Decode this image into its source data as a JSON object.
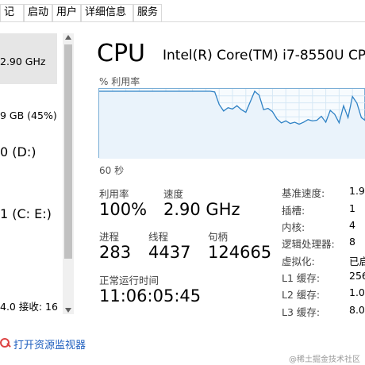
{
  "tabs": [
    "记录",
    "启动",
    "用户",
    "详细信息",
    "服务"
  ],
  "left_list": {
    "item1_value": "2.90 GHz",
    "item2_value": "9 GB (45%)",
    "item3_value": "0 (D:)",
    "item4_value": "1 (C: E:)",
    "item5_value": "4.0 接收: 16"
  },
  "footer_link": "打开资源监视器",
  "cpu": {
    "title": "CPU",
    "model": "Intel(R) Core(TM) i7-8550U CP",
    "util_axis_label": "% 利用率",
    "seconds_label": "60 秒",
    "utilization_label": "利用率",
    "utilization_value": "100%",
    "speed_label": "速度",
    "speed_value": "2.90 GHz",
    "processes_label": "进程",
    "processes_value": "283",
    "threads_label": "线程",
    "threads_value": "4437",
    "handles_label": "句柄",
    "handles_value": "124665",
    "uptime_label": "正常运行时间",
    "uptime_value": "11:06:05:45"
  },
  "specs": [
    {
      "key": "基准速度:",
      "value": "1.9"
    },
    {
      "key": "插槽:",
      "value": "1"
    },
    {
      "key": "内核:",
      "value": "4"
    },
    {
      "key": "逻辑处理器:",
      "value": "8"
    },
    {
      "key": "虚拟化:",
      "value": "已启"
    },
    {
      "key": "L1 缓存:",
      "value": "256"
    },
    {
      "key": "L2 缓存:",
      "value": "1.0"
    },
    {
      "key": "L3 缓存:",
      "value": "8.0"
    }
  ],
  "chart_data": {
    "type": "line",
    "ylim": [
      0,
      100
    ],
    "xlim": [
      0,
      60
    ],
    "grid": true,
    "x": [
      0,
      5,
      10,
      15,
      20,
      25,
      26,
      27,
      28,
      29,
      30,
      31,
      32,
      33,
      34,
      35,
      36,
      37,
      38,
      39,
      40,
      41,
      42,
      43,
      44,
      45,
      46,
      47,
      48,
      49,
      50,
      51,
      52,
      53,
      54,
      55,
      56,
      57,
      58,
      59,
      60
    ],
    "values": [
      100,
      100,
      100,
      100,
      100,
      100,
      99,
      80,
      70,
      75,
      73,
      78,
      72,
      68,
      84,
      100,
      94,
      72,
      74,
      69,
      58,
      52,
      55,
      51,
      53,
      50,
      53,
      57,
      55,
      56,
      62,
      53,
      71,
      65,
      52,
      78,
      60,
      92,
      82,
      60,
      55
    ]
  },
  "watermark": "@稀土掘金技术社区"
}
